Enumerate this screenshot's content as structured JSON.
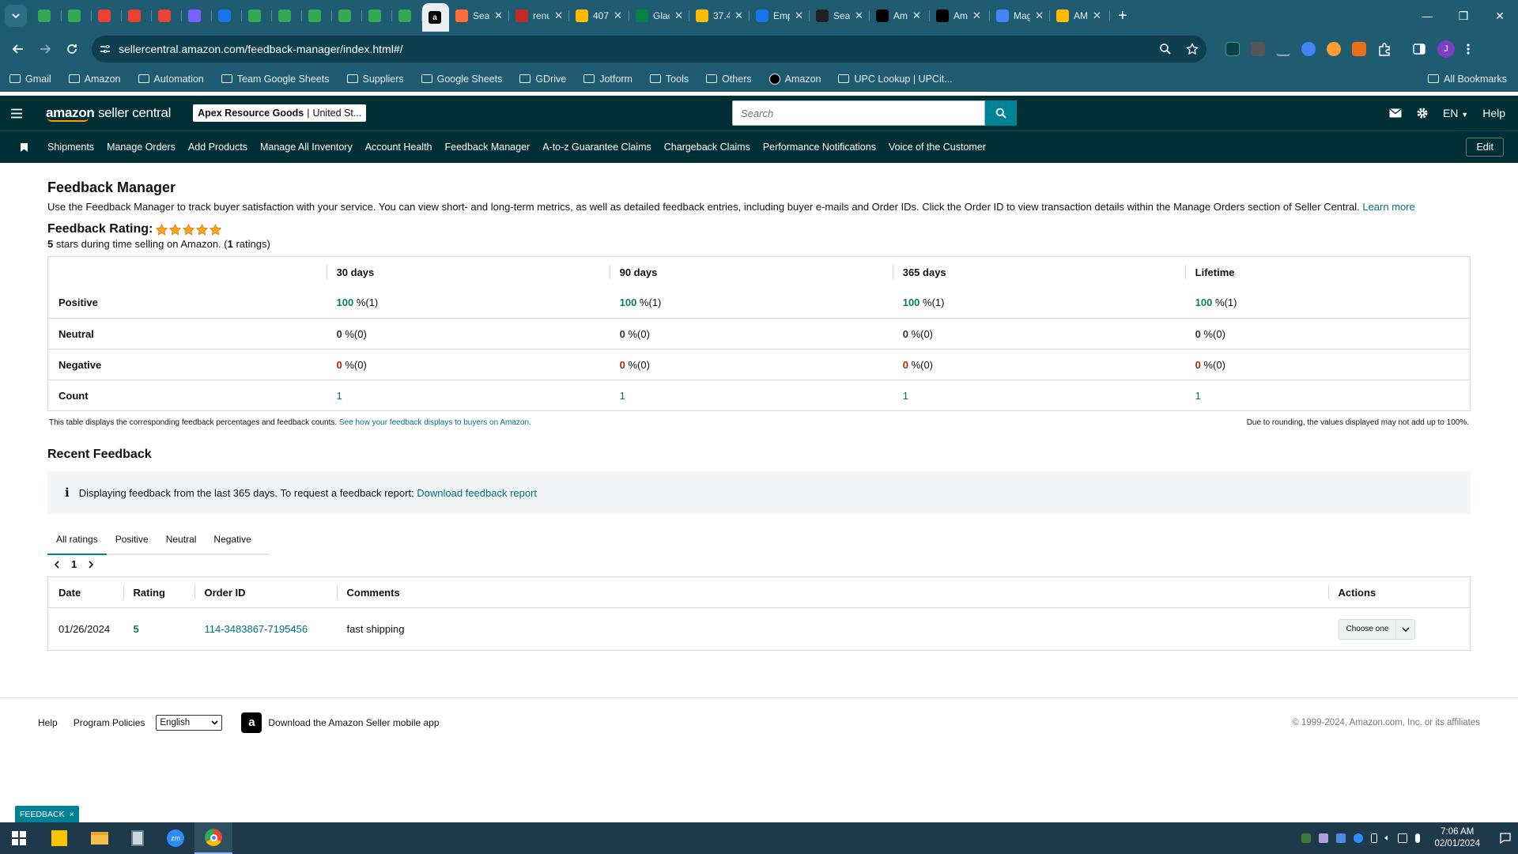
{
  "browser": {
    "tabs": [
      {
        "label": "",
        "color": "#34a853"
      },
      {
        "label": "",
        "color": "#34a853"
      },
      {
        "label": "",
        "color": "#ea4335"
      },
      {
        "label": "",
        "color": "#ea4335"
      },
      {
        "label": "",
        "color": "#ea4335"
      },
      {
        "label": "",
        "color": "#7b61ff"
      },
      {
        "label": "",
        "color": "#1a73e8"
      },
      {
        "label": "",
        "color": "#34a853"
      },
      {
        "label": "",
        "color": "#34a853"
      },
      {
        "label": "",
        "color": "#34a853"
      },
      {
        "label": "",
        "color": "#34a853"
      },
      {
        "label": "",
        "color": "#34a853"
      },
      {
        "label": "",
        "color": "#34a853"
      },
      {
        "label": "",
        "color": "#000000",
        "active": true
      },
      {
        "label": "Sea",
        "color": "#ff6d3a"
      },
      {
        "label": "renu",
        "color": "#c62828"
      },
      {
        "label": "407",
        "color": "#fbbc04"
      },
      {
        "label": "Glac",
        "color": "#0b8043"
      },
      {
        "label": "37.4",
        "color": "#fbbc04"
      },
      {
        "label": "Emp",
        "color": "#1a73e8"
      },
      {
        "label": "Sea",
        "color": "#202124"
      },
      {
        "label": "Am",
        "color": "#000000"
      },
      {
        "label": "Am",
        "color": "#000000"
      },
      {
        "label": "Mag",
        "color": "#4285f4"
      },
      {
        "label": "AM",
        "color": "#fbbc04"
      }
    ],
    "url": "sellercentral.amazon.com/feedback-manager/index.html#/",
    "bookmarks": [
      "Gmail",
      "Amazon",
      "Automation",
      "Team Google Sheets",
      "Suppliers",
      "Google Sheets",
      "GDrive",
      "Jotform",
      "Tools",
      "Others",
      "Amazon",
      "UPC Lookup | UPCit..."
    ],
    "all_bookmarks": "All Bookmarks"
  },
  "header": {
    "logo_brand": "amazon",
    "logo_product": "seller central",
    "account_name": "Apex Resource Goods",
    "account_region": "United St...",
    "search_placeholder": "Search",
    "language": "EN",
    "help": "Help"
  },
  "nav": {
    "items": [
      "Shipments",
      "Manage Orders",
      "Add Products",
      "Manage All Inventory",
      "Account Health",
      "Feedback Manager",
      "A-to-z Guarantee Claims",
      "Chargeback Claims",
      "Performance Notifications",
      "Voice of the Customer"
    ],
    "edit": "Edit"
  },
  "page": {
    "title": "Feedback Manager",
    "description": "Use the Feedback Manager to track buyer satisfaction with your service. You can view short- and long-term metrics, as well as detailed feedback entries, including buyer e-mails and Order IDs. Click the Order ID to view transaction details within the Manage Orders section of Seller Central.",
    "learn_more": "Learn more",
    "rating_label": "Feedback Rating:",
    "rating_stars": 5,
    "rating_value": "5",
    "rating_text_mid": " stars during time selling on Amazon. (",
    "rating_count": "1",
    "rating_text_end": " ratings)"
  },
  "metrics": {
    "columns": [
      "30 days",
      "90 days",
      "365 days",
      "Lifetime"
    ],
    "rows": [
      {
        "label": "Positive",
        "tone": "green",
        "cells": [
          {
            "v": "100",
            "u": " %(1)"
          },
          {
            "v": "100",
            "u": " %(1)"
          },
          {
            "v": "100",
            "u": " %(1)"
          },
          {
            "v": "100",
            "u": " %(1)"
          }
        ]
      },
      {
        "label": "Neutral",
        "tone": "gray",
        "cells": [
          {
            "v": "0",
            "u": " %(0)"
          },
          {
            "v": "0",
            "u": " %(0)"
          },
          {
            "v": "0",
            "u": " %(0)"
          },
          {
            "v": "0",
            "u": " %(0)"
          }
        ]
      },
      {
        "label": "Negative",
        "tone": "red",
        "cells": [
          {
            "v": "0",
            "u": " %(0)"
          },
          {
            "v": "0",
            "u": " %(0)"
          },
          {
            "v": "0",
            "u": " %(0)"
          },
          {
            "v": "0",
            "u": " %(0)"
          }
        ]
      },
      {
        "label": "Count",
        "tone": "link",
        "cells": [
          {
            "v": "1",
            "u": ""
          },
          {
            "v": "1",
            "u": ""
          },
          {
            "v": "1",
            "u": ""
          },
          {
            "v": "1",
            "u": ""
          }
        ]
      }
    ],
    "note_left": "This table displays the corresponding feedback percentages and feedback counts.",
    "note_link": "See how your feedback displays to buyers on Amazon.",
    "note_right": "Due to rounding, the values displayed may not add up to 100%."
  },
  "recent": {
    "title": "Recent Feedback",
    "alert_text": "Displaying feedback from the last 365 days. To request a feedback report:",
    "alert_link": "Download feedback report",
    "tabs": [
      "All ratings",
      "Positive",
      "Neutral",
      "Negative"
    ],
    "page": "1",
    "columns": [
      "Date",
      "Rating",
      "Order ID",
      "Comments",
      "Actions"
    ],
    "rows": [
      {
        "date": "01/26/2024",
        "rating": "5",
        "order_id": "114-3483867-7195456",
        "comment": "fast shipping",
        "action": "Choose one"
      }
    ]
  },
  "footer": {
    "help": "Help",
    "policies": "Program Policies",
    "language": "English",
    "app_text": "Download the Amazon Seller mobile app",
    "copyright": "© 1999-2024, Amazon.com, Inc. or its affiliates"
  },
  "feedback_tag": "FEEDBACK",
  "taskbar": {
    "time": "7:06 AM",
    "date": "02/01/2024"
  },
  "colors": {
    "header_bg": "#002f36",
    "accent": "#008296",
    "positive": "#067d62",
    "negative": "#b12704",
    "link": "#007185",
    "star": "#ffa41c"
  }
}
